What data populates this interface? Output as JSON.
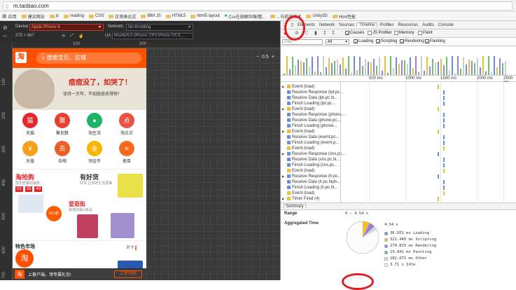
{
  "browser": {
    "url": "m.taobao.com",
    "bookmarks": [
      "应用",
      "建议网站",
      "js",
      "reading",
      "CSS",
      "正则表达式",
      "IBM JS",
      "HTML5",
      "html5 layout",
      "Css在线解压缩/整...",
      "...与前端技术",
      "Unity3D",
      "Html性能"
    ]
  },
  "devtoolbar": {
    "device_label": "Device",
    "device_value": "Apple iPhone 6",
    "network_label": "Network",
    "network_value": "No throttling",
    "dims": "375 × 667",
    "ua": "Mozilla/5.0 (iPhone; CPU iPhone OS 8_...",
    "zoom": "0.5"
  },
  "rulers": {
    "top": [
      "100",
      "200"
    ],
    "left": [
      "100",
      "200",
      "300",
      "400",
      "500",
      "600",
      "700"
    ]
  },
  "phone": {
    "logo": "淘",
    "search_placeholder": "搜索宝贝、店铺",
    "banner_title": "痘痘没了，如哭了！",
    "banner_sub": "坚持一万年，不如痘痘去得快！",
    "icons": [
      {
        "label": "天猫",
        "color": "#e5262b",
        "glyph": "猫"
      },
      {
        "label": "聚划算",
        "color": "#e8402f",
        "glyph": "聚"
      },
      {
        "label": "淘生活",
        "color": "#18b566",
        "glyph": "●"
      },
      {
        "label": "淘点点",
        "color": "#f04f45",
        "glyph": "点"
      },
      {
        "label": "充值",
        "color": "#f8a01b",
        "glyph": "¥"
      },
      {
        "label": "去啊",
        "color": "#ee5e22",
        "glyph": "去"
      },
      {
        "label": "领金币",
        "color": "#f9b400",
        "glyph": "金"
      },
      {
        "label": "类目",
        "color": "#fa6a1e",
        "glyph": "≡"
      }
    ],
    "sec_a_title": "淘抢购",
    "sec_a_sub": "限定质量的爆款",
    "countdown": [
      "01",
      "25",
      "49"
    ],
    "discount": "36.6折",
    "sec_b_title": "有好货",
    "sec_b_sub": "好货 让你的生活更美",
    "sec_c_title": "爱逛街",
    "sec_c_sub": "最潮流最in单品",
    "sec_d_title": "特色市场",
    "sec_d_more": "更多",
    "footer_logo": "淘",
    "footer_text": "上客户端，领专属礼包!",
    "footer_button": "立即领取"
  },
  "devtools": {
    "tabs": [
      "Elements",
      "Network",
      "Sources",
      "Timeline",
      "Profiles",
      "Resources",
      "Audits",
      "Console"
    ],
    "active_tab": "Timeline",
    "options": [
      {
        "label": "Causes",
        "checked": true
      },
      {
        "label": "JS Profiler",
        "checked": false
      },
      {
        "label": "Memory",
        "checked": false
      },
      {
        "label": "Paint",
        "checked": false
      }
    ],
    "filter_placeholder": "Filter",
    "filter_select": "All",
    "filter_checks": [
      {
        "label": "Loading",
        "checked": true
      },
      {
        "label": "Scripting",
        "checked": true
      },
      {
        "label": "Rendering",
        "checked": true
      },
      {
        "label": "Painting",
        "checked": true
      }
    ],
    "ruler_ticks": [
      "500 ms",
      "1000 ms",
      "1500 ms",
      "2000 ms",
      "2500 ms"
    ],
    "events": [
      {
        "label": "Event (load)",
        "color": "#f0c030"
      },
      {
        "label": "Receive Response (lpt.pc...",
        "color": "#6a8fd8"
      },
      {
        "label": "Receive Data (lpt.pc.hi...",
        "color": "#6a8fd8"
      },
      {
        "label": "Finish Loading (lpt.pc...",
        "color": "#6a8fd8"
      },
      {
        "label": "Event (load)",
        "color": "#f0c030"
      },
      {
        "label": "Receive Response (phone...",
        "color": "#6a8fd8"
      },
      {
        "label": "Receive Data (phone.pc...",
        "color": "#6a8fd8"
      },
      {
        "label": "Finish Loading (phone...",
        "color": "#6a8fd8"
      },
      {
        "label": "Event (load)",
        "color": "#f0c030"
      },
      {
        "label": "Receive Data (event.pc...",
        "color": "#6a8fd8"
      },
      {
        "label": "Finish Loading (event.p...",
        "color": "#6a8fd8"
      },
      {
        "label": "Event (load)",
        "color": "#f0c030"
      },
      {
        "label": "Receive Response (sns.pc...",
        "color": "#6a8fd8"
      },
      {
        "label": "Receive Data (sns.pc.hi...",
        "color": "#6a8fd8"
      },
      {
        "label": "Finish Loading (sns.pc...",
        "color": "#6a8fd8"
      },
      {
        "label": "Event (load)",
        "color": "#f0c030"
      },
      {
        "label": "Receive Response (h.pc...",
        "color": "#6a8fd8"
      },
      {
        "label": "Receive Data (h.pc.hiph...",
        "color": "#6a8fd8"
      },
      {
        "label": "Finish Loading (h.pc.hi...",
        "color": "#6a8fd8"
      },
      {
        "label": "Event (load)",
        "color": "#f0c030"
      },
      {
        "label": "Timer Fired (4)",
        "color": "#f0c030"
      }
    ],
    "summary_tab": "Summary",
    "range_label": "Range",
    "range_value": "0 – 4.54 s",
    "agg_label": "Aggregated Time",
    "total": "4.54 s",
    "legend": [
      {
        "label": "36.951 ms Loading",
        "color": "#5b8fd6"
      },
      {
        "label": "321.440 ms Scripting",
        "color": "#f0c030"
      },
      {
        "label": "270.815 ms Rendering",
        "color": "#9b7fe0"
      },
      {
        "label": "19.941 ms Painting",
        "color": "#6cc070"
      },
      {
        "label": "182.071 ms Other",
        "color": "#d8d8d8"
      },
      {
        "label": "3.71 s Idle",
        "color": "#ffffff"
      }
    ]
  }
}
